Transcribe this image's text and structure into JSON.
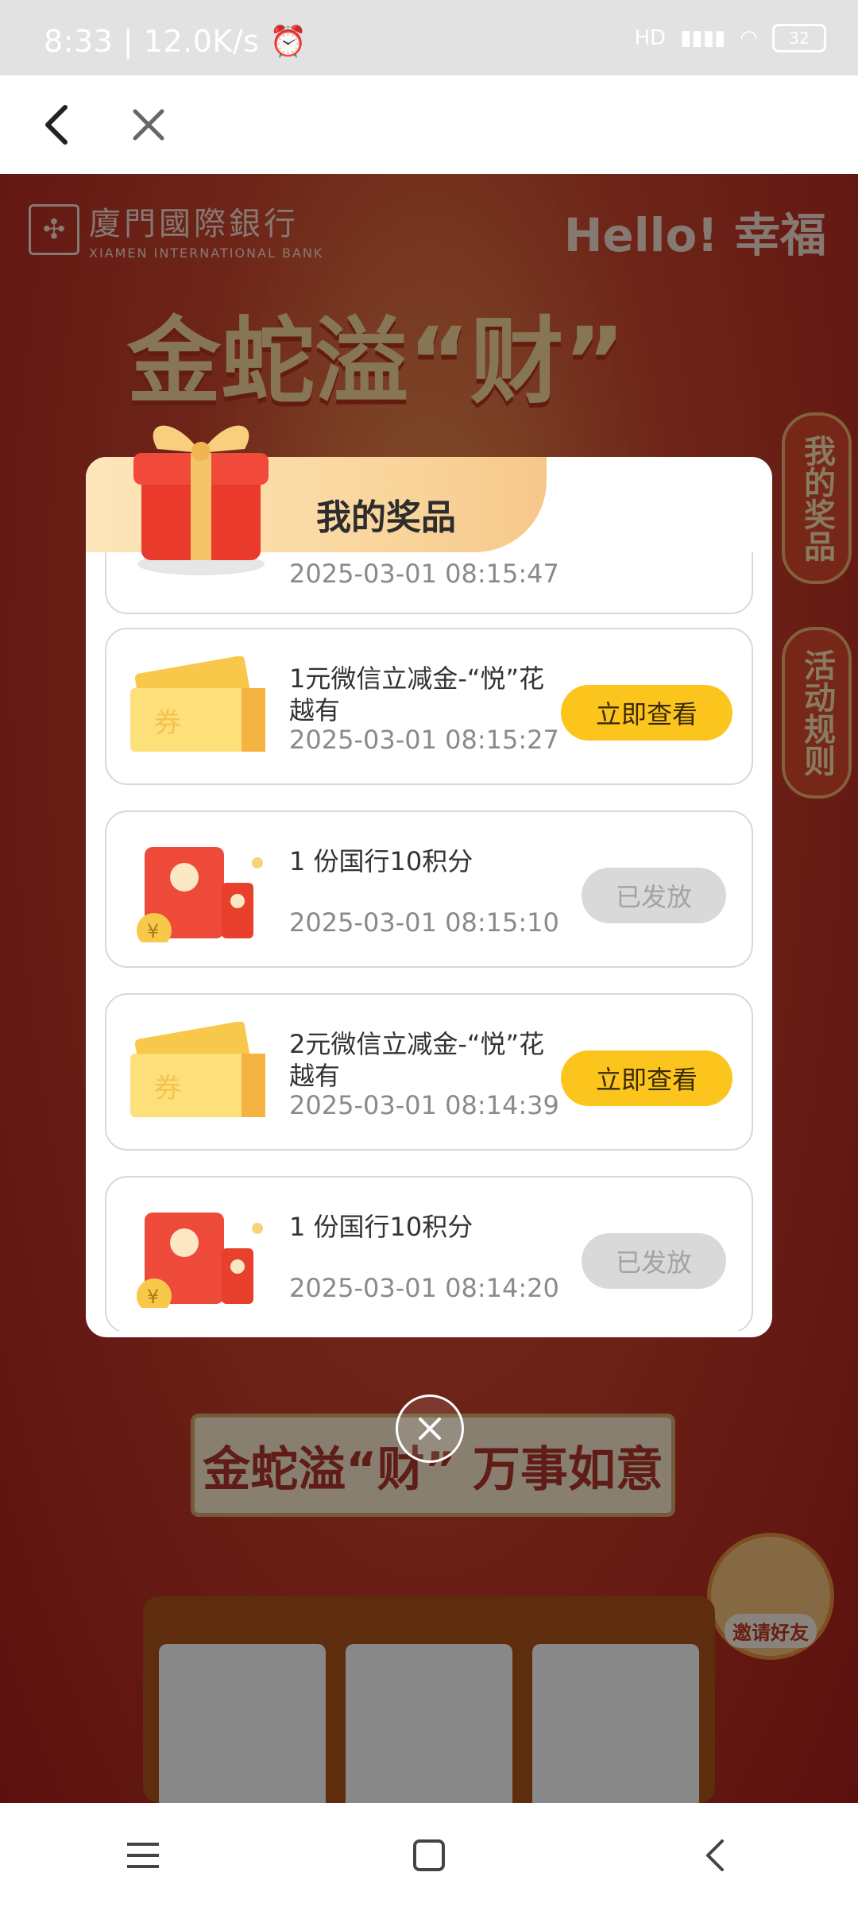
{
  "status_bar": {
    "time": "8:33",
    "speed": "12.0K/s",
    "network": "HD",
    "battery": "32"
  },
  "nav": {
    "back_icon": "chevron-left-icon",
    "close_icon": "close-icon"
  },
  "background": {
    "bank_name": "廈門國際銀行",
    "bank_name_en": "XIAMEN INTERNATIONAL BANK",
    "brand_slogan": "Hello! 幸福",
    "campaign_title": "金蛇溢“财”",
    "side_tab_prizes": "我的奖品",
    "side_tab_rules": "活动规则",
    "banner_text": "金蛇溢“财” 万事如意",
    "invite_label": "邀请好友"
  },
  "modal": {
    "title": "我的奖品",
    "partial_time": "2025-03-01 08:15:47",
    "items": [
      {
        "name": "1元微信立减金-“悦”花越有",
        "time": "2025-03-01 08:15:27",
        "action": "立即查看",
        "type": "coupon"
      },
      {
        "name": "1 份国行10积分",
        "time": "2025-03-01 08:15:10",
        "action": "已发放",
        "type": "redpacket"
      },
      {
        "name": "2元微信立减金-“悦”花越有",
        "time": "2025-03-01 08:14:39",
        "action": "立即查看",
        "type": "coupon"
      },
      {
        "name": "1 份国行10积分",
        "time": "2025-03-01 08:14:20",
        "action": "已发放",
        "type": "redpacket"
      }
    ]
  },
  "colors": {
    "accent_yellow": "#fcc51e",
    "disabled_gray": "#d9d9d9",
    "campaign_red": "#c9452d"
  }
}
